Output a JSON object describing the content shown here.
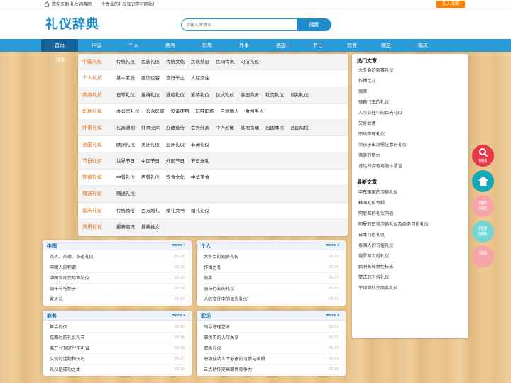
{
  "topbar": {
    "welcome": "欢迎来到 礼仪词典网 ，一个专业的礼仪知识学习网站！",
    "fav_btn": "加入收藏"
  },
  "header": {
    "logo": "礼仪辞典",
    "search_placeholder": "请输入关键词",
    "search_btn": "搜索"
  },
  "nav": [
    "首页",
    "中国",
    "个人",
    "商务",
    "职场",
    "外事",
    "各国",
    "节日",
    "饮食",
    "赠送",
    "婚庆"
  ],
  "news_label": "资讯",
  "menu": [
    {
      "cat": "中国礼仪",
      "links": [
        "传统礼仪",
        "民族礼仪",
        "传统文化",
        "民族禁忌",
        "民间传说",
        "习俗礼仪"
      ]
    },
    {
      "cat": "个人礼仪",
      "links": [
        "基本素质",
        "服饰仪容",
        "言行举止",
        "人际交往"
      ]
    },
    {
      "cat": "商务礼仪",
      "links": [
        "日常礼仪",
        "接待礼仪",
        "通信礼仪",
        "宴请礼仪",
        "仪式礼仪",
        "各国商务",
        "社交礼仪",
        "谈判礼仪"
      ]
    },
    {
      "cat": "职场礼仪",
      "links": [
        "办公室礼仪",
        "公众区域",
        "设备使用",
        "玩味职场",
        "白领丽人",
        "金领男人"
      ]
    },
    {
      "cat": "外事礼仪",
      "links": [
        "礼宾通则",
        "外事交际",
        "迎送接待",
        "会务外宾",
        "个人形像",
        "基地管理",
        "出国事项",
        "各国风俗"
      ]
    },
    {
      "cat": "各国礼仪",
      "links": [
        "欧洲礼仪",
        "美洲礼仪",
        "亚洲礼仪",
        "非洲礼仪"
      ]
    },
    {
      "cat": "节日礼仪",
      "links": [
        "世界节日",
        "中国节日",
        "外国节日",
        "节日送礼"
      ]
    },
    {
      "cat": "饮食礼仪",
      "links": [
        "中餐礼仪",
        "西餐礼仪",
        "饮食文化",
        "中华美食"
      ]
    },
    {
      "cat": "赠送礼仪",
      "links": [
        "赠送礼仪"
      ]
    },
    {
      "cat": "婚庆礼仪",
      "links": [
        "传统婚俗",
        "西方婚礼",
        "婚礼文书",
        "婚礼礼仪"
      ]
    },
    {
      "cat": "资讯礼仪",
      "links": [
        "最新资讯",
        "最新推文"
      ]
    }
  ],
  "sidebar": {
    "hot_title": "热门文章",
    "hot": [
      "大冬会的观赛礼仪",
      "作揖之礼",
      "微笑",
      "骑自行车的礼仪",
      "人际交往中的目光礼仪",
      "欠身致意",
      "职场称呼礼仪",
      "带孩子出游需注意的礼仪",
      "微笑的魅力",
      "说话的姿态与肢体语言"
    ],
    "new_title": "最新文章",
    "new": [
      "中东国家的习俗礼仪",
      "韩国礼仪专辑",
      "阿联酋的礼仪习俗",
      "阿曼的日常习俗礼仪及商务习俗礼仪",
      "日本习俗礼仪",
      "泰国人的习俗礼仪",
      "俄罗斯习俗礼仪",
      "欧洲名城特色标志",
      "蒙古的习俗礼仪",
      "菲律宾社交商务礼仪"
    ]
  },
  "boxes": [
    {
      "title": "中国",
      "more": "more +",
      "items": [
        {
          "t": "茶人，茶德、茶道礼仪",
          "d": "08-20"
        },
        {
          "t": "中国人的称谓",
          "d": "08-23"
        },
        {
          "t": "中国汉代交际舞礼仪",
          "d": "08-23"
        },
        {
          "t": "端午节吃粽子",
          "d": "08-24"
        },
        {
          "t": "茶之礼",
          "d": "08-23"
        }
      ]
    },
    {
      "title": "个人",
      "more": "more +",
      "items": [
        {
          "t": "大冬会的观赛礼仪",
          "d": "08-25"
        },
        {
          "t": "作揖之礼",
          "d": "08-25"
        },
        {
          "t": "微笑",
          "d": "08-25"
        },
        {
          "t": "骑自行车的礼仪",
          "d": "08-25"
        },
        {
          "t": "人际交往中的目光礼仪",
          "d": "08-25"
        }
      ]
    },
    {
      "title": "商务",
      "more": "more +",
      "items": [
        {
          "t": "舞会礼仪",
          "d": "08-21"
        },
        {
          "t": "见面时的礼仪礼节",
          "d": "08-16"
        },
        {
          "t": "离开“打招呼”不可省",
          "d": "08-18"
        },
        {
          "t": "交谈的话题和技巧",
          "d": "08-17"
        },
        {
          "t": "礼仪是成功之本",
          "d": "08-10"
        }
      ]
    },
    {
      "title": "职场",
      "more": "more +",
      "items": [
        {
          "t": "领导管理艺术",
          "d": "08-25"
        },
        {
          "t": "职场中的人际关系",
          "d": "08-25"
        },
        {
          "t": "职场礼仪",
          "d": "08-25"
        },
        {
          "t": "职场成功人士必备的习惯与素质",
          "d": "08-25"
        },
        {
          "t": "三点助你提高职场竞争力",
          "d": "08-25"
        }
      ]
    }
  ],
  "floats": [
    {
      "label": "快搜",
      "icon": "search-icon",
      "color": "#e63a4b"
    },
    {
      "label": "",
      "icon": "home-icon",
      "color": "#16a8b7"
    },
    {
      "label": "网站导航",
      "icon": "",
      "color": "#f7a3a8"
    },
    {
      "label": "快速搜索",
      "icon": "",
      "color": "#76d4d4"
    },
    {
      "label": "顶部",
      "icon": "",
      "color": "#f7a3a8"
    }
  ]
}
